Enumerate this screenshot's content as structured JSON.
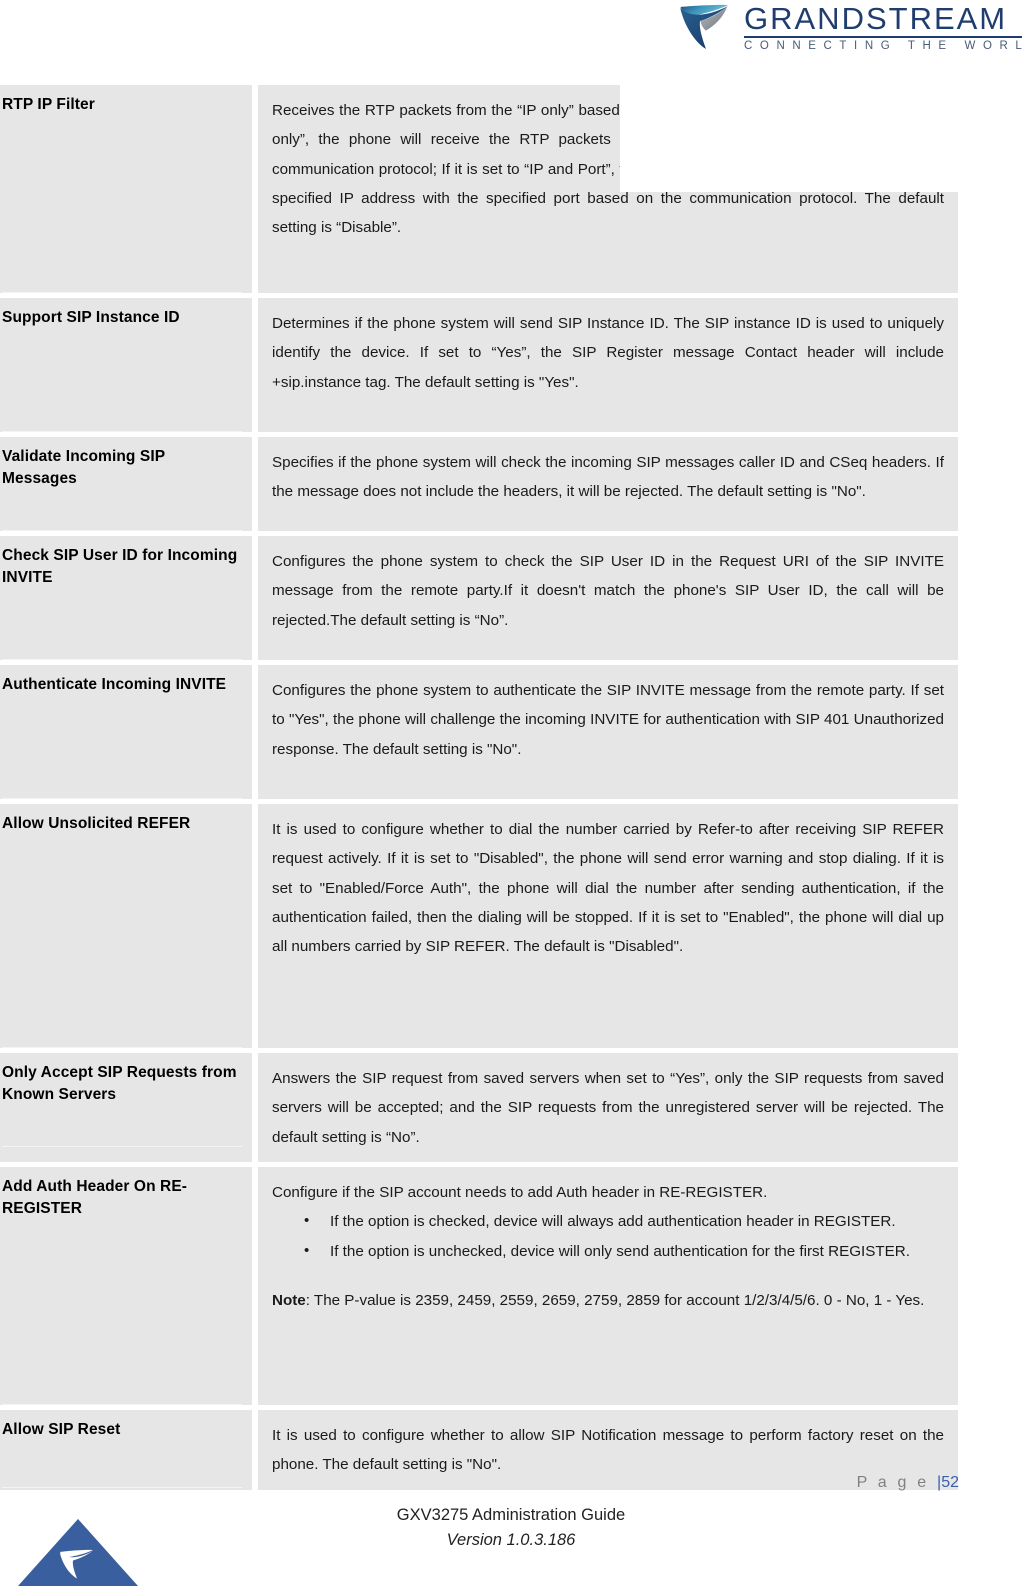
{
  "header": {
    "logo": {
      "mark_icon": "grandstream-swoosh-icon",
      "wordmark": "GRANDSTREAM",
      "tagline": "CONNECTING THE WORLD",
      "brand_color": "#1f3d6e",
      "accent_color": "#2f7fa8"
    }
  },
  "table": {
    "rows": [
      {
        "label": "RTP IP Filter",
        "description": "Receives the RTP packets from the “IP only” based on the communication protocol. If it is set to “IP only”, the phone will receive the RTP packets from the specified IP address based on the communication protocol; If it is set to “IP and Port”, the phone will receive the RTP packets from the specified IP address with the specified port based on the communication protocol. The default setting is “Disable”."
      },
      {
        "label": "Support SIP Instance ID",
        "description": "Determines if the phone system will send SIP Instance ID. The SIP instance ID is used to uniquely identify the device. If set to “Yes”, the SIP Register message Contact header will include +sip.instance tag. The default setting is \"Yes\"."
      },
      {
        "label": "Validate Incoming SIP Messages",
        "description": "Specifies if the phone system will check the incoming SIP messages caller ID and CSeq headers. If the message does not include the headers, it will be rejected. The default setting is \"No\"."
      },
      {
        "label": "Check SIP User ID for Incoming INVITE",
        "description": "Configures the phone system to check the SIP User ID in the Request URI of the SIP INVITE message from the remote party.If it doesn't match the phone's SIP User ID, the call will be rejected.The default setting is “No”."
      },
      {
        "label": "Authenticate Incoming INVITE",
        "description": "Configures the phone system to authenticate the SIP INVITE message from the remote party. If set to \"Yes\", the phone will challenge the incoming INVITE for authentication with SIP 401 Unauthorized response. The default setting is \"No\"."
      },
      {
        "label": "Allow Unsolicited REFER",
        "description": "It is used to configure whether to dial the number carried by Refer-to after receiving SIP REFER request actively. If it is set to \"Disabled\", the phone will send error warning and stop dialing. If it is set to \"Enabled/Force Auth\", the phone will dial the number after sending authentication, if the authentication failed, then the dialing will be stopped. If it is set to \"Enabled\", the phone will dial up all numbers carried by SIP REFER. The default is \"Disabled\"."
      },
      {
        "label": "Only Accept SIP Requests from Known Servers",
        "description": "Answers the SIP request from saved servers when set to “Yes”, only the SIP requests from saved servers will be accepted; and the SIP requests from the unregistered server will be rejected. The default setting is “No”."
      },
      {
        "label": "Add Auth Header On RE-REGISTER",
        "description": "Configure if the SIP account needs to add Auth header in RE-REGISTER.",
        "bullets": [
          "If the option is checked, device will always add authentication header in REGISTER.",
          "If the option is unchecked, device will only send authentication for the first REGISTER."
        ],
        "note_label": "Note",
        "note_text": ": The P-value is 2359, 2459, 2559, 2659, 2759, 2859 for account 1/2/3/4/5/6. 0 - No, 1 - Yes."
      },
      {
        "label": "Allow SIP Reset",
        "description": "It is used to configure whether to allow SIP Notification message to perform factory reset on the phone. The default setting is \"No\"."
      }
    ]
  },
  "footer": {
    "page_word": "P a g e ",
    "page_separator_and_number": "|52",
    "document_title": "GXV3275 Administration Guide",
    "version": "Version 1.0.3.186",
    "logo_icon": "grandstream-triangle-icon",
    "logo_color": "#3a5f9e"
  }
}
